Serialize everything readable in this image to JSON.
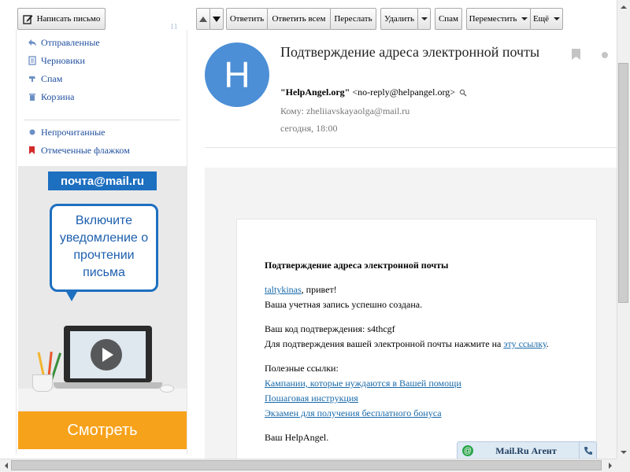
{
  "toolbar": {
    "compose_label": "Написать письмо",
    "reply_label": "Ответить",
    "reply_all_label": "Ответить всем",
    "forward_label": "Переслать",
    "delete_label": "Удалить",
    "spam_label": "Спам",
    "move_label": "Переместить",
    "more_label": "Ещё"
  },
  "sidebar": {
    "unread_count": "11",
    "folders": [
      {
        "label": "Отправленные",
        "icon": "sent-icon"
      },
      {
        "label": "Черновики",
        "icon": "drafts-icon"
      },
      {
        "label": "Спам",
        "icon": "spam-icon"
      },
      {
        "label": "Корзина",
        "icon": "trash-icon"
      }
    ],
    "filters": [
      {
        "label": "Непрочитанные",
        "icon": "unread-dot-icon"
      },
      {
        "label": "Отмеченные флажком",
        "icon": "flag-icon"
      }
    ]
  },
  "ad": {
    "logo_text": "почта@mail.ru",
    "bubble_text": "Включите уведомление о прочтении письма",
    "cta_label": "Смотреть",
    "brand_color": "#1d6fc0",
    "cta_color": "#f7a21b"
  },
  "message": {
    "avatar_letter": "H",
    "avatar_color": "#4c8fd6",
    "subject": "Подтверждение адреса электронной почты",
    "from_name": "\"HelpAngel.org\"",
    "from_address": "<no-reply@helpangel.org>",
    "to": "Кому: zheliiavskayaolga@mail.ru",
    "date": "сегодня, 18:00"
  },
  "body": {
    "heading": "Подтверждение адреса электронной почты",
    "username_link": "taltykinas",
    "greeting_suffix": ", привет!",
    "created_text": "Ваша учетная запись успешно создана.",
    "code_text": "Ваш код подтверждения: s4thcgf",
    "confirm_prefix": "Для подтверждения вашей электронной почты нажмите на ",
    "confirm_link": "эту ссылку",
    "confirm_suffix": ".",
    "useful_links_title": "Полезные ссылки:",
    "links": [
      "Кампании, которые нуждаются в Вашей помощи",
      "Пошаговая инструкция",
      "Экзамен для получения бесплатного бонуса"
    ],
    "signature": "Ваш HelpAngel."
  },
  "agent": {
    "label": "Mail.Ru Агент"
  }
}
